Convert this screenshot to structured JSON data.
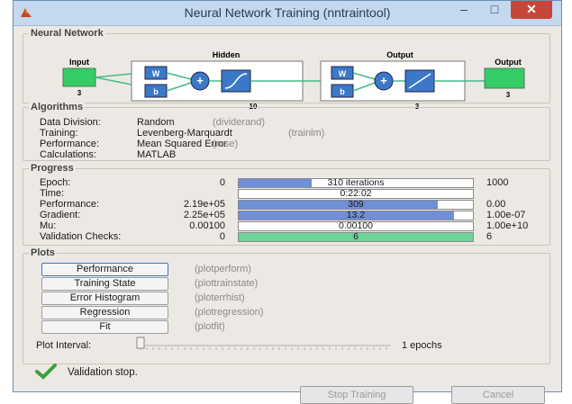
{
  "window": {
    "title": "Neural Network Training (nntraintool)",
    "minimize_glyph": "–",
    "maximize_glyph": "□",
    "close_glyph": "✕"
  },
  "network": {
    "group_title": "Neural Network",
    "input_label": "Input",
    "input_size": "3",
    "hidden_label": "Hidden",
    "hidden_size": "10",
    "output_layer_label": "Output",
    "output_layer_size": "3",
    "output_label": "Output",
    "output_size": "3",
    "weight_label": "W",
    "bias_label": "b"
  },
  "algorithms": {
    "group_title": "Algorithms",
    "rows": [
      {
        "label": "Data Division:",
        "value": "Random",
        "fn": "(dividerand)"
      },
      {
        "label": "Training:",
        "value": "Levenberg-Marquardt",
        "fn": "(trainlm)"
      },
      {
        "label": "Performance:",
        "value": "Mean Squared Error",
        "fn": "(mse)"
      },
      {
        "label": "Calculations:",
        "value": "MATLAB",
        "fn": ""
      }
    ]
  },
  "progress": {
    "group_title": "Progress",
    "rows": [
      {
        "label": "Epoch:",
        "start": "0",
        "bar_text": "310 iterations",
        "end": "1000",
        "fill": 0.31
      },
      {
        "label": "Time:",
        "start": "",
        "bar_text": "0:22:02",
        "end": "",
        "fill": 0
      },
      {
        "label": "Performance:",
        "start": "2.19e+05",
        "bar_text": "309",
        "end": "0.00",
        "fill": 0.85
      },
      {
        "label": "Gradient:",
        "start": "2.25e+05",
        "bar_text": "13.2",
        "end": "1.00e-07",
        "fill": 0.92
      },
      {
        "label": "Mu:",
        "start": "0.00100",
        "bar_text": "0.00100",
        "end": "1.00e+10",
        "fill": 0
      },
      {
        "label": "Validation Checks:",
        "start": "0",
        "bar_text": "6",
        "end": "6",
        "fill": 1.0
      }
    ],
    "bar_color": "#6f8fd8",
    "validation_color": "#6fd49a"
  },
  "plots": {
    "group_title": "Plots",
    "buttons": [
      {
        "label": "Performance",
        "fn": "(plotperform)"
      },
      {
        "label": "Training State",
        "fn": "(plottrainstate)"
      },
      {
        "label": "Error Histogram",
        "fn": "(ploterrhist)"
      },
      {
        "label": "Regression",
        "fn": "(plotregression)"
      },
      {
        "label": "Fit",
        "fn": "(plotfit)"
      }
    ],
    "interval_label": "Plot Interval:",
    "interval_value": "1 epochs"
  },
  "status": {
    "icon": "checkmark-icon",
    "text": "Validation stop."
  },
  "footer": {
    "stop_label": "Stop Training",
    "cancel_label": "Cancel"
  }
}
